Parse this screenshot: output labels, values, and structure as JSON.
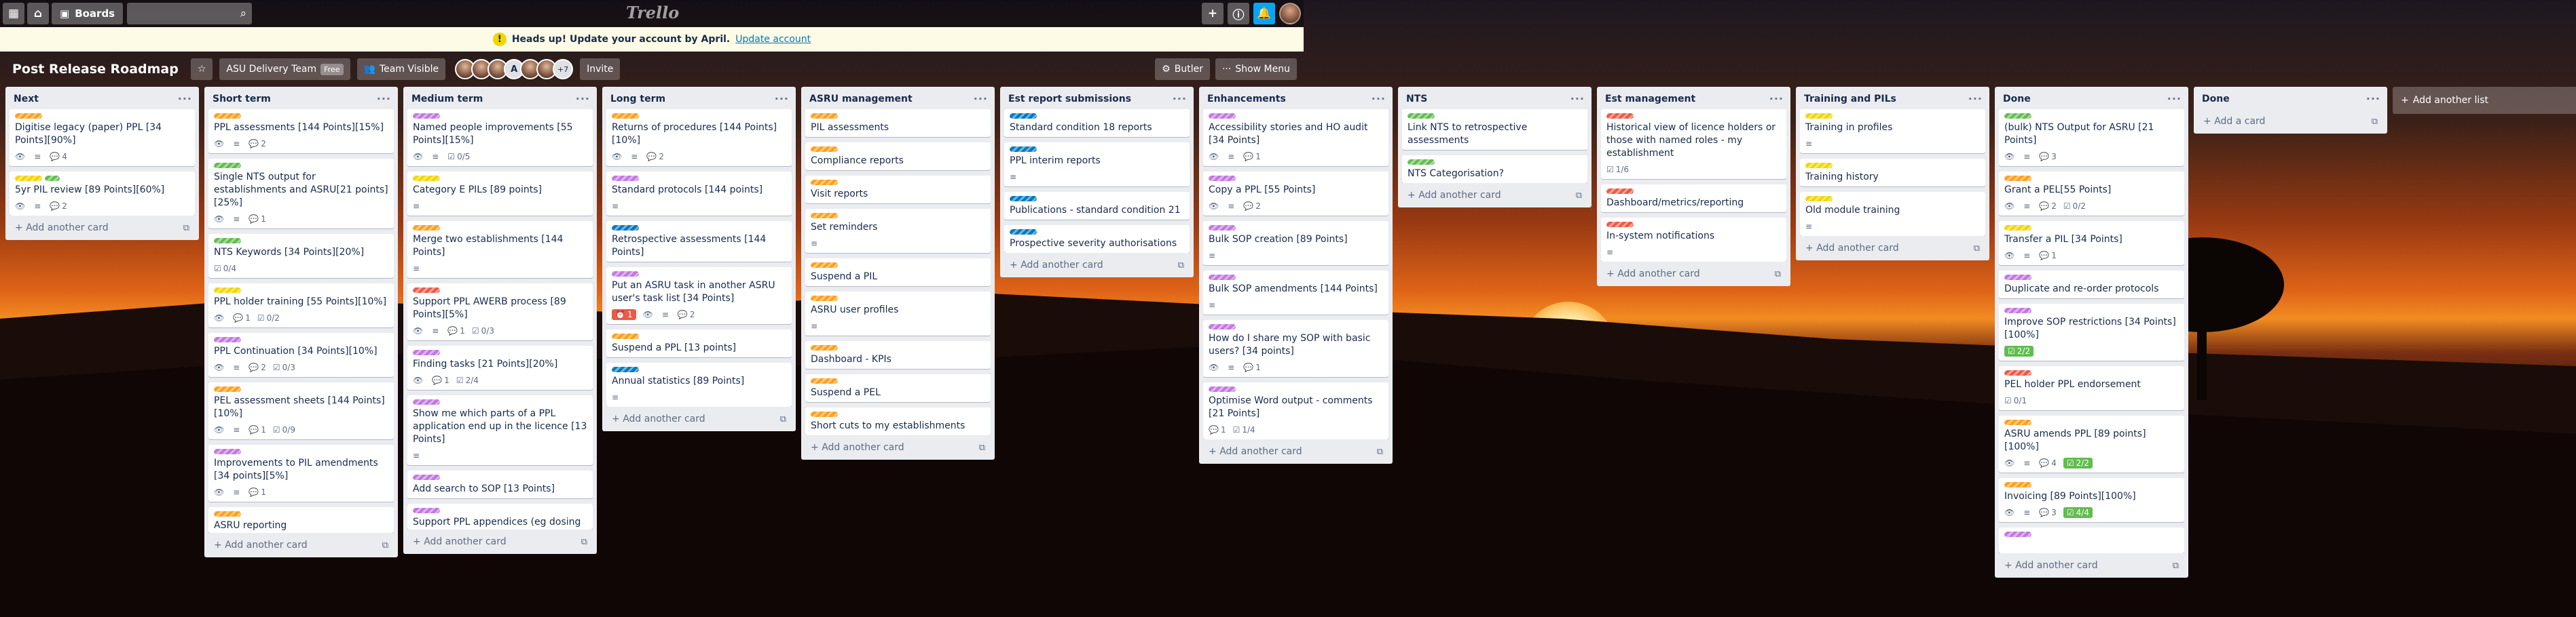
{
  "header": {
    "boards_label": "Boards",
    "logo_text": "Trello"
  },
  "banner": {
    "message": "Heads up! Update your account by April.",
    "link": "Update account"
  },
  "boardbar": {
    "title": "Post Release Roadmap",
    "team": "ASU Delivery Team",
    "team_badge": "Free",
    "visibility": "Team Visible",
    "member_initial": "A",
    "member_more": "+7",
    "invite": "Invite",
    "butler": "Butler",
    "show_menu": "Show Menu"
  },
  "add_card_label": "Add another card",
  "add_list_label": "Add another list",
  "lists": [
    {
      "title": "Next",
      "cards": [
        {
          "labels": [
            "orange"
          ],
          "title": "Digitise legacy (paper) PPL [34 Points][90%]",
          "badges": [
            {
              "icon": "eye",
              "text": ""
            },
            {
              "icon": "desc",
              "text": ""
            },
            {
              "icon": "comment",
              "text": "4"
            }
          ]
        },
        {
          "labels": [
            "yellow",
            "green"
          ],
          "title": "5yr PIL review [89 Points][60%]",
          "badges": [
            {
              "icon": "eye",
              "text": ""
            },
            {
              "icon": "desc",
              "text": ""
            },
            {
              "icon": "comment",
              "text": "2"
            }
          ]
        }
      ]
    },
    {
      "title": "Short term",
      "cards": [
        {
          "labels": [
            "orange"
          ],
          "title": "PPL assessments [144 Points][15%]",
          "badges": [
            {
              "icon": "eye",
              "text": ""
            },
            {
              "icon": "desc",
              "text": ""
            },
            {
              "icon": "comment",
              "text": "2"
            }
          ]
        },
        {
          "labels": [
            "green"
          ],
          "title": "Single NTS output for establishments and ASRU[21 points][25%]",
          "badges": [
            {
              "icon": "eye",
              "text": ""
            },
            {
              "icon": "desc",
              "text": ""
            },
            {
              "icon": "comment",
              "text": "1"
            }
          ]
        },
        {
          "labels": [
            "green"
          ],
          "title": "NTS Keywords [34 Points][20%]",
          "badges": [
            {
              "icon": "check",
              "text": "0/4"
            }
          ]
        },
        {
          "labels": [
            "yellow"
          ],
          "title": "PPL holder training [55 Points][10%]",
          "badges": [
            {
              "icon": "eye",
              "text": ""
            },
            {
              "icon": "comment",
              "text": "1"
            },
            {
              "icon": "check",
              "text": "0/2"
            }
          ]
        },
        {
          "labels": [
            "purple"
          ],
          "title": "PPL Continuation [34 Points][10%]",
          "badges": [
            {
              "icon": "eye",
              "text": ""
            },
            {
              "icon": "desc",
              "text": ""
            },
            {
              "icon": "comment",
              "text": "2"
            },
            {
              "icon": "check",
              "text": "0/3"
            }
          ]
        },
        {
          "labels": [
            "orange"
          ],
          "title": "PEL assessment sheets [144 Points][10%]",
          "badges": [
            {
              "icon": "eye",
              "text": ""
            },
            {
              "icon": "desc",
              "text": ""
            },
            {
              "icon": "comment",
              "text": "1"
            },
            {
              "icon": "check",
              "text": "0/9"
            }
          ]
        },
        {
          "labels": [
            "purple"
          ],
          "title": "Improvements to PIL amendments [34 points][5%]",
          "badges": [
            {
              "icon": "eye",
              "text": ""
            },
            {
              "icon": "desc",
              "text": ""
            },
            {
              "icon": "comment",
              "text": "1"
            }
          ]
        },
        {
          "labels": [
            "orange"
          ],
          "title": "ASRU reporting",
          "badges": [],
          "partial": true
        }
      ]
    },
    {
      "title": "Medium term",
      "cards": [
        {
          "labels": [
            "purple"
          ],
          "title": "Named people improvements [55 Points][15%]",
          "badges": [
            {
              "icon": "eye",
              "text": ""
            },
            {
              "icon": "desc",
              "text": ""
            },
            {
              "icon": "check",
              "text": "0/5"
            }
          ]
        },
        {
          "labels": [
            "yellow"
          ],
          "title": "Category E PILs [89 points]",
          "badges": [
            {
              "icon": "desc",
              "text": ""
            }
          ]
        },
        {
          "labels": [
            "orange"
          ],
          "title": "Merge two establishments [144 Points]",
          "badges": [
            {
              "icon": "desc",
              "text": ""
            }
          ]
        },
        {
          "labels": [
            "red"
          ],
          "title": "Support PPL AWERB process [89 Points][5%]",
          "badges": [
            {
              "icon": "eye",
              "text": ""
            },
            {
              "icon": "desc",
              "text": ""
            },
            {
              "icon": "comment",
              "text": "1"
            },
            {
              "icon": "check",
              "text": "0/3"
            }
          ]
        },
        {
          "labels": [
            "purple"
          ],
          "title": "Finding tasks [21 Points][20%]",
          "badges": [
            {
              "icon": "eye",
              "text": ""
            },
            {
              "icon": "comment",
              "text": "1"
            },
            {
              "icon": "check",
              "text": "2/4"
            }
          ]
        },
        {
          "labels": [
            "purple"
          ],
          "title": "Show me which parts of a PPL application end up in the licence [13 Points]",
          "badges": [
            {
              "icon": "desc",
              "text": ""
            }
          ]
        },
        {
          "labels": [
            "purple"
          ],
          "title": "Add search to SOP [13 Points]",
          "badges": []
        },
        {
          "labels": [
            "purple"
          ],
          "title": "Support PPL appendices (eg dosing",
          "badges": [],
          "partial": true
        }
      ]
    },
    {
      "title": "Long term",
      "cards": [
        {
          "labels": [
            "orange"
          ],
          "title": "Returns of procedures [144 Points][10%]",
          "badges": [
            {
              "icon": "eye",
              "text": ""
            },
            {
              "icon": "desc",
              "text": ""
            },
            {
              "icon": "comment",
              "text": "2"
            }
          ]
        },
        {
          "labels": [
            "purple"
          ],
          "title": "Standard protocols [144 points]",
          "badges": [
            {
              "icon": "desc",
              "text": ""
            }
          ]
        },
        {
          "labels": [
            "blue"
          ],
          "title": "Retrospective assessments [144 Points]",
          "badges": []
        },
        {
          "labels": [
            "purple"
          ],
          "title": "Put an ASRU task in another ASRU user's task list [34 Points]",
          "badges": [
            {
              "icon": "alert",
              "text": "1"
            },
            {
              "icon": "eye",
              "text": ""
            },
            {
              "icon": "desc",
              "text": ""
            },
            {
              "icon": "comment",
              "text": "2"
            }
          ]
        },
        {
          "labels": [
            "orange"
          ],
          "title": "Suspend a PPL [13 points]",
          "badges": []
        },
        {
          "labels": [
            "blue"
          ],
          "title": "Annual statistics [89 Points]",
          "badges": [
            {
              "icon": "desc",
              "text": ""
            }
          ]
        }
      ]
    },
    {
      "title": "ASRU management",
      "cards": [
        {
          "labels": [
            "orange"
          ],
          "title": "PIL assessments",
          "badges": []
        },
        {
          "labels": [
            "orange"
          ],
          "title": "Compliance reports",
          "badges": []
        },
        {
          "labels": [
            "orange"
          ],
          "title": "Visit reports",
          "badges": []
        },
        {
          "labels": [
            "orange"
          ],
          "title": "Set reminders",
          "badges": [
            {
              "icon": "desc",
              "text": ""
            }
          ]
        },
        {
          "labels": [
            "orange"
          ],
          "title": "Suspend a PIL",
          "badges": []
        },
        {
          "labels": [
            "orange"
          ],
          "title": "ASRU user profiles",
          "badges": [
            {
              "icon": "desc",
              "text": ""
            }
          ]
        },
        {
          "labels": [
            "orange"
          ],
          "title": "Dashboard - KPIs",
          "badges": []
        },
        {
          "labels": [
            "orange"
          ],
          "title": "Suspend a PEL",
          "badges": []
        },
        {
          "labels": [
            "orange"
          ],
          "title": "Short cuts to my establishments",
          "badges": []
        }
      ]
    },
    {
      "title": "Est report submissions",
      "cards": [
        {
          "labels": [
            "blue"
          ],
          "title": "Standard condition 18 reports",
          "badges": []
        },
        {
          "labels": [
            "blue"
          ],
          "title": "PPL interim reports",
          "badges": [
            {
              "icon": "desc",
              "text": ""
            }
          ]
        },
        {
          "labels": [
            "blue"
          ],
          "title": "Publications - standard condition 21",
          "badges": []
        },
        {
          "labels": [
            "blue"
          ],
          "title": "Prospective severity authorisations",
          "badges": []
        }
      ]
    },
    {
      "title": "Enhancements",
      "cards": [
        {
          "labels": [
            "purple"
          ],
          "title": "Accessibility stories and HO audit [34 Points]",
          "badges": [
            {
              "icon": "eye",
              "text": ""
            },
            {
              "icon": "desc",
              "text": ""
            },
            {
              "icon": "comment",
              "text": "1"
            }
          ]
        },
        {
          "labels": [
            "purple"
          ],
          "title": "Copy a PPL [55 Points]",
          "badges": [
            {
              "icon": "eye",
              "text": ""
            },
            {
              "icon": "desc",
              "text": ""
            },
            {
              "icon": "comment",
              "text": "2"
            }
          ]
        },
        {
          "labels": [
            "purple"
          ],
          "title": "Bulk SOP creation [89 Points]",
          "badges": [
            {
              "icon": "desc",
              "text": ""
            }
          ]
        },
        {
          "labels": [
            "purple"
          ],
          "title": "Bulk SOP amendments [144 Points]",
          "badges": [
            {
              "icon": "desc",
              "text": ""
            }
          ]
        },
        {
          "labels": [
            "purple"
          ],
          "title": "How do I share my SOP with basic users? [34 points]",
          "badges": [
            {
              "icon": "eye",
              "text": ""
            },
            {
              "icon": "desc",
              "text": ""
            },
            {
              "icon": "comment",
              "text": "1"
            }
          ]
        },
        {
          "labels": [
            "purple"
          ],
          "title": "Optimise Word output - comments [21 Points]",
          "badges": [
            {
              "icon": "comment",
              "text": "1"
            },
            {
              "icon": "check",
              "text": "1/4"
            }
          ]
        }
      ]
    },
    {
      "title": "NTS",
      "cards": [
        {
          "labels": [
            "green"
          ],
          "title": "Link NTS to retrospective assessments",
          "badges": []
        },
        {
          "labels": [
            "green"
          ],
          "title": "NTS Categorisation?",
          "badges": []
        }
      ]
    },
    {
      "title": "Est management",
      "cards": [
        {
          "labels": [
            "red"
          ],
          "title": "Historical view of licence holders or those with named roles - my establishment",
          "badges": [
            {
              "icon": "check",
              "text": "1/6"
            }
          ]
        },
        {
          "labels": [
            "red"
          ],
          "title": "Dashboard/metrics/reporting",
          "badges": []
        },
        {
          "labels": [
            "red"
          ],
          "title": "In-system notifications",
          "badges": [
            {
              "icon": "desc",
              "text": ""
            }
          ]
        }
      ]
    },
    {
      "title": "Training and PILs",
      "cards": [
        {
          "labels": [
            "yellow"
          ],
          "title": "Training in profiles",
          "badges": [
            {
              "icon": "desc",
              "text": ""
            }
          ]
        },
        {
          "labels": [
            "yellow"
          ],
          "title": "Training history",
          "badges": []
        },
        {
          "labels": [
            "yellow"
          ],
          "title": "Old module training",
          "badges": [
            {
              "icon": "desc",
              "text": ""
            }
          ]
        }
      ]
    },
    {
      "title": "Done",
      "cards": [
        {
          "labels": [
            "green"
          ],
          "title": "(bulk) NTS Output for ASRU [21 Points]",
          "badges": [
            {
              "icon": "eye",
              "text": ""
            },
            {
              "icon": "desc",
              "text": ""
            },
            {
              "icon": "comment",
              "text": "3"
            }
          ]
        },
        {
          "labels": [
            "orange"
          ],
          "title": "Grant a PEL[55 Points]",
          "badges": [
            {
              "icon": "eye",
              "text": ""
            },
            {
              "icon": "desc",
              "text": ""
            },
            {
              "icon": "comment",
              "text": "2"
            },
            {
              "icon": "check",
              "text": "0/2"
            }
          ]
        },
        {
          "labels": [
            "yellow"
          ],
          "title": "Transfer a PIL [34 Points]",
          "badges": [
            {
              "icon": "eye",
              "text": ""
            },
            {
              "icon": "desc",
              "text": ""
            },
            {
              "icon": "comment",
              "text": "1"
            }
          ]
        },
        {
          "labels": [
            "purple"
          ],
          "title": "Duplicate and re-order protocols",
          "badges": []
        },
        {
          "labels": [
            "purple"
          ],
          "title": "Improve SOP restrictions [34 Points][100%]",
          "badges": [
            {
              "icon": "done",
              "text": "2/2"
            }
          ]
        },
        {
          "labels": [
            "red"
          ],
          "title": "PEL holder PPL endorsement",
          "badges": [
            {
              "icon": "check",
              "text": "0/1"
            }
          ]
        },
        {
          "labels": [
            "orange"
          ],
          "title": "ASRU amends PPL [89 points][100%]",
          "badges": [
            {
              "icon": "eye",
              "text": ""
            },
            {
              "icon": "desc",
              "text": ""
            },
            {
              "icon": "comment",
              "text": "4"
            },
            {
              "icon": "done",
              "text": "2/2"
            }
          ]
        },
        {
          "labels": [
            "orange"
          ],
          "title": "Invoicing [89 Points][100%]",
          "badges": [
            {
              "icon": "eye",
              "text": ""
            },
            {
              "icon": "desc",
              "text": ""
            },
            {
              "icon": "comment",
              "text": "3"
            },
            {
              "icon": "done",
              "text": "4/4"
            }
          ]
        },
        {
          "labels": [
            "purple"
          ],
          "title": "",
          "badges": [],
          "partial": true
        }
      ]
    },
    {
      "title": "Done",
      "cards": [],
      "add_label": "Add a card"
    }
  ]
}
